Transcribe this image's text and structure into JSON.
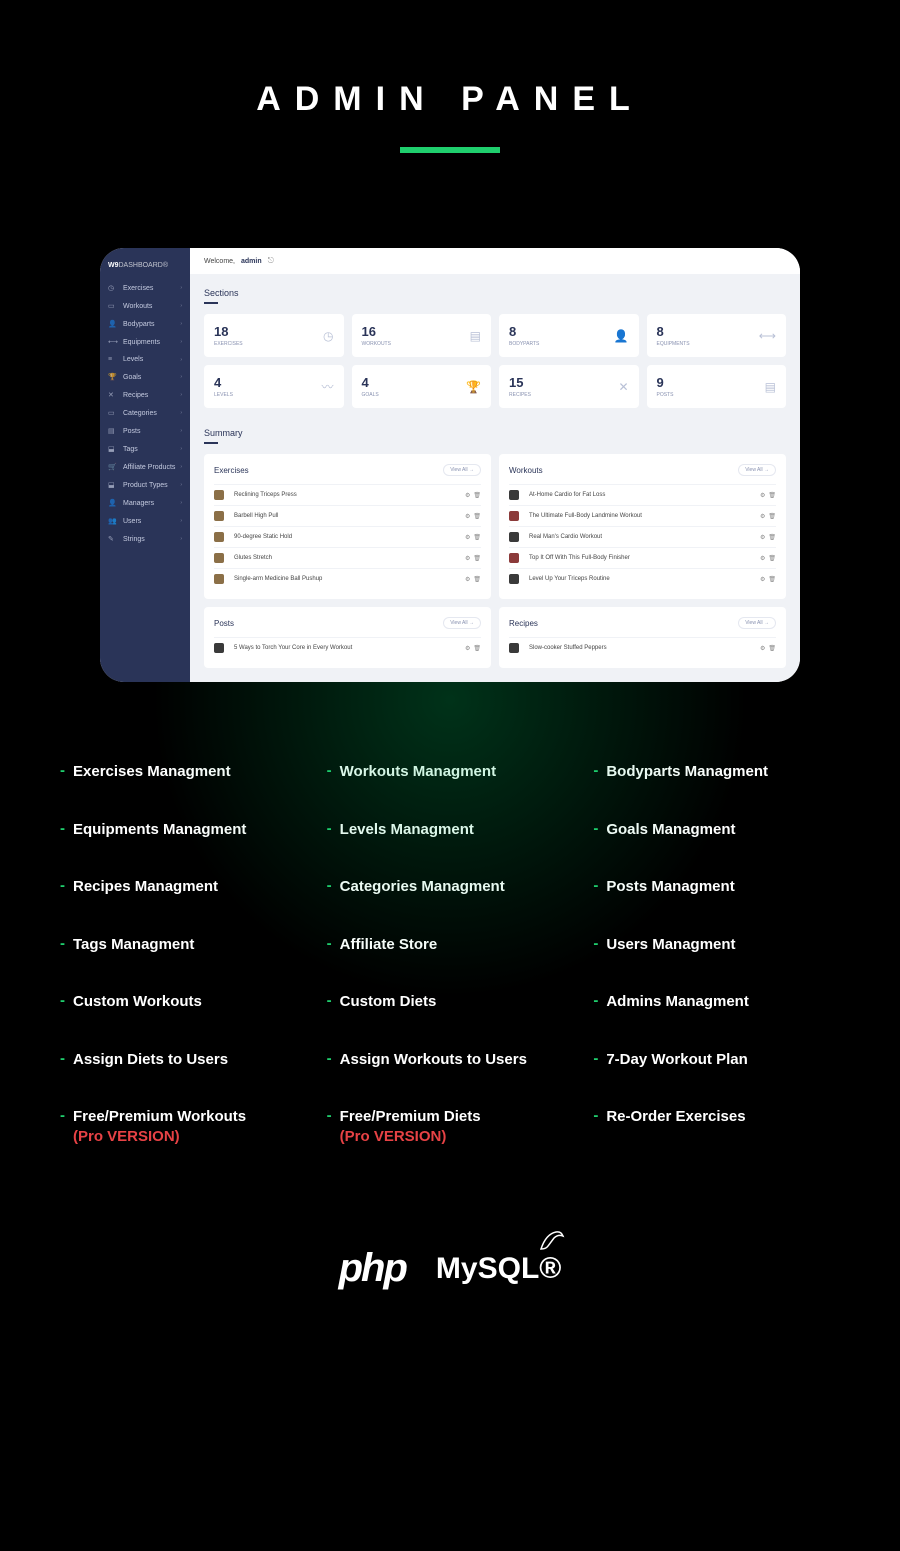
{
  "page_title": "ADMIN PANEL",
  "dashboard": {
    "logo_bold": "W9",
    "logo_light": "DASHBOARD®",
    "welcome": "Welcome,",
    "user": "admin",
    "sidebar": [
      {
        "icon": "◷",
        "label": "Exercises"
      },
      {
        "icon": "▭",
        "label": "Workouts"
      },
      {
        "icon": "👤",
        "label": "Bodyparts"
      },
      {
        "icon": "⟷",
        "label": "Equipments"
      },
      {
        "icon": "≡",
        "label": "Levels"
      },
      {
        "icon": "🏆",
        "label": "Goals"
      },
      {
        "icon": "✕",
        "label": "Recipes"
      },
      {
        "icon": "▭",
        "label": "Categories"
      },
      {
        "icon": "▤",
        "label": "Posts"
      },
      {
        "icon": "⬓",
        "label": "Tags"
      },
      {
        "icon": "🛒",
        "label": "Affiliate Products"
      },
      {
        "icon": "⬓",
        "label": "Product Types"
      },
      {
        "icon": "👤",
        "label": "Managers"
      },
      {
        "icon": "👥",
        "label": "Users"
      },
      {
        "icon": "✎",
        "label": "Strings"
      }
    ],
    "sections_title": "Sections",
    "stats": [
      {
        "num": "18",
        "lbl": "EXERCISES",
        "icon": "◷"
      },
      {
        "num": "16",
        "lbl": "WORKOUTS",
        "icon": "▤"
      },
      {
        "num": "8",
        "lbl": "BODYPARTS",
        "icon": "👤"
      },
      {
        "num": "8",
        "lbl": "EQUIPMENTS",
        "icon": "⟷"
      },
      {
        "num": "4",
        "lbl": "LEVELS",
        "icon": "〰"
      },
      {
        "num": "4",
        "lbl": "GOALS",
        "icon": "🏆"
      },
      {
        "num": "15",
        "lbl": "RECIPES",
        "icon": "✕"
      },
      {
        "num": "9",
        "lbl": "POSTS",
        "icon": "▤"
      }
    ],
    "summary_title": "Summary",
    "view_all": "View All →",
    "lists": {
      "exercises": {
        "title": "Exercises",
        "items": [
          "Reclining Triceps Press",
          "Barbell High Pull",
          "90-degree Static Hold",
          "Glutes Stretch",
          "Single-arm Medicine Ball Pushup"
        ]
      },
      "workouts": {
        "title": "Workouts",
        "items": [
          "At-Home Cardio for Fat Loss",
          "The Ultimate Full-Body Landmine Workout",
          "Real Man's Cardio Workout",
          "Top It Off With This Full-Body Finisher",
          "Level Up Your Triceps Routine"
        ]
      },
      "posts": {
        "title": "Posts",
        "items": [
          "5 Ways to Torch Your Core in Every Workout"
        ]
      },
      "recipes": {
        "title": "Recipes",
        "items": [
          "Slow-cooker Stuffed Peppers"
        ]
      }
    }
  },
  "features": [
    {
      "text": "Exercises Managment"
    },
    {
      "text": "Workouts Managment"
    },
    {
      "text": "Bodyparts Managment"
    },
    {
      "text": "Equipments Managment"
    },
    {
      "text": "Levels Managment"
    },
    {
      "text": "Goals Managment"
    },
    {
      "text": "Recipes Managment"
    },
    {
      "text": "Categories Managment"
    },
    {
      "text": "Posts Managment"
    },
    {
      "text": "Tags Managment"
    },
    {
      "text": "Affiliate Store"
    },
    {
      "text": "Users Managment"
    },
    {
      "text": "Custom Workouts"
    },
    {
      "text": "Custom Diets"
    },
    {
      "text": "Admins Managment"
    },
    {
      "text": "Assign Diets to Users"
    },
    {
      "text": "Assign Workouts to Users"
    },
    {
      "text": "7-Day Workout Plan"
    },
    {
      "text": "Free/Premium Workouts",
      "pro": "(Pro VERSION)"
    },
    {
      "text": "Free/Premium Diets",
      "pro": "(Pro VERSION)"
    },
    {
      "text": "Re-Order Exercises"
    }
  ],
  "tech": {
    "php": "php",
    "mysql": "MySQL®"
  }
}
